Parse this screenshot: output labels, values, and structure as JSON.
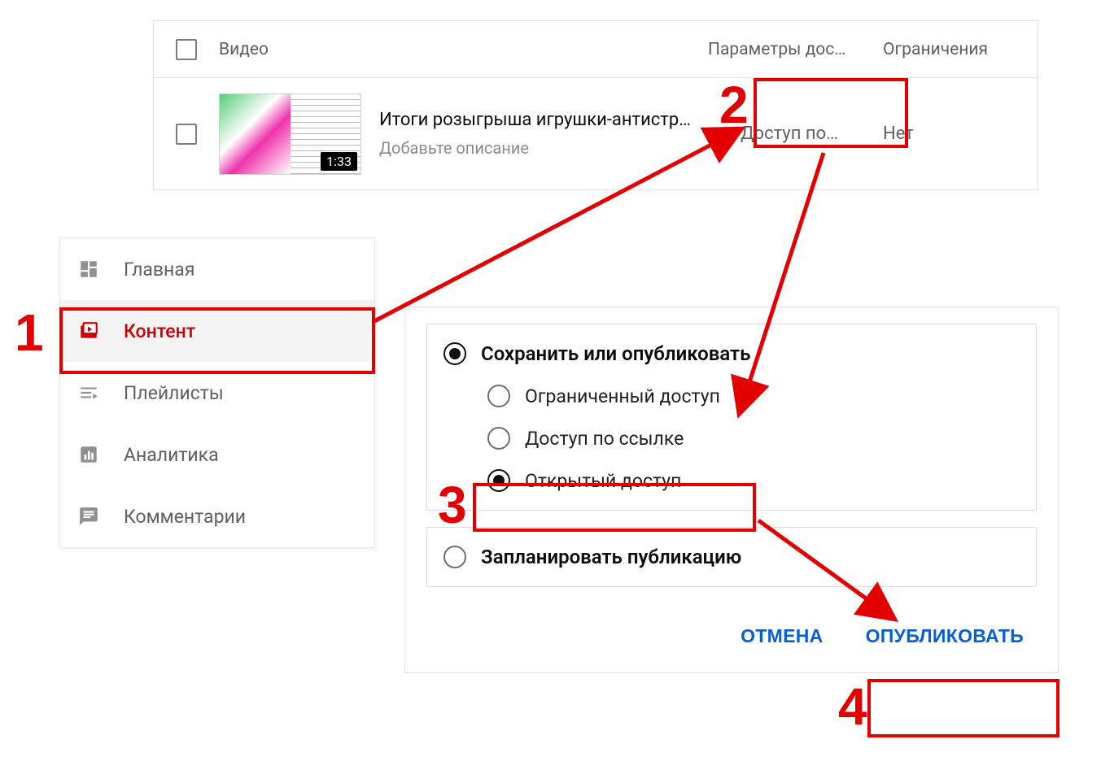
{
  "table": {
    "col_video": "Видео",
    "col_access": "Параметры дос…",
    "col_restrictions": "Ограничения",
    "row": {
      "title": "Итоги розыгрыша игрушки-антистр…",
      "description_placeholder": "Добавьте описание",
      "duration": "1:33",
      "access_label": "Доступ по…",
      "restrictions_value": "Нет"
    }
  },
  "sidebar": {
    "items": [
      {
        "label": "Главная"
      },
      {
        "label": "Контент"
      },
      {
        "label": "Плейлисты"
      },
      {
        "label": "Аналитика"
      },
      {
        "label": "Комментарии"
      }
    ]
  },
  "dialog": {
    "save_publish": "Сохранить или опубликовать",
    "private": "Ограниченный доступ",
    "unlisted": "Доступ по ссылке",
    "public": "Открытый доступ",
    "schedule": "Запланировать публикацию",
    "cancel": "ОТМЕНА",
    "publish": "ОПУБЛИКОВАТЬ"
  },
  "annotations": {
    "n1": "1",
    "n2": "2",
    "n3": "3",
    "n4": "4"
  }
}
